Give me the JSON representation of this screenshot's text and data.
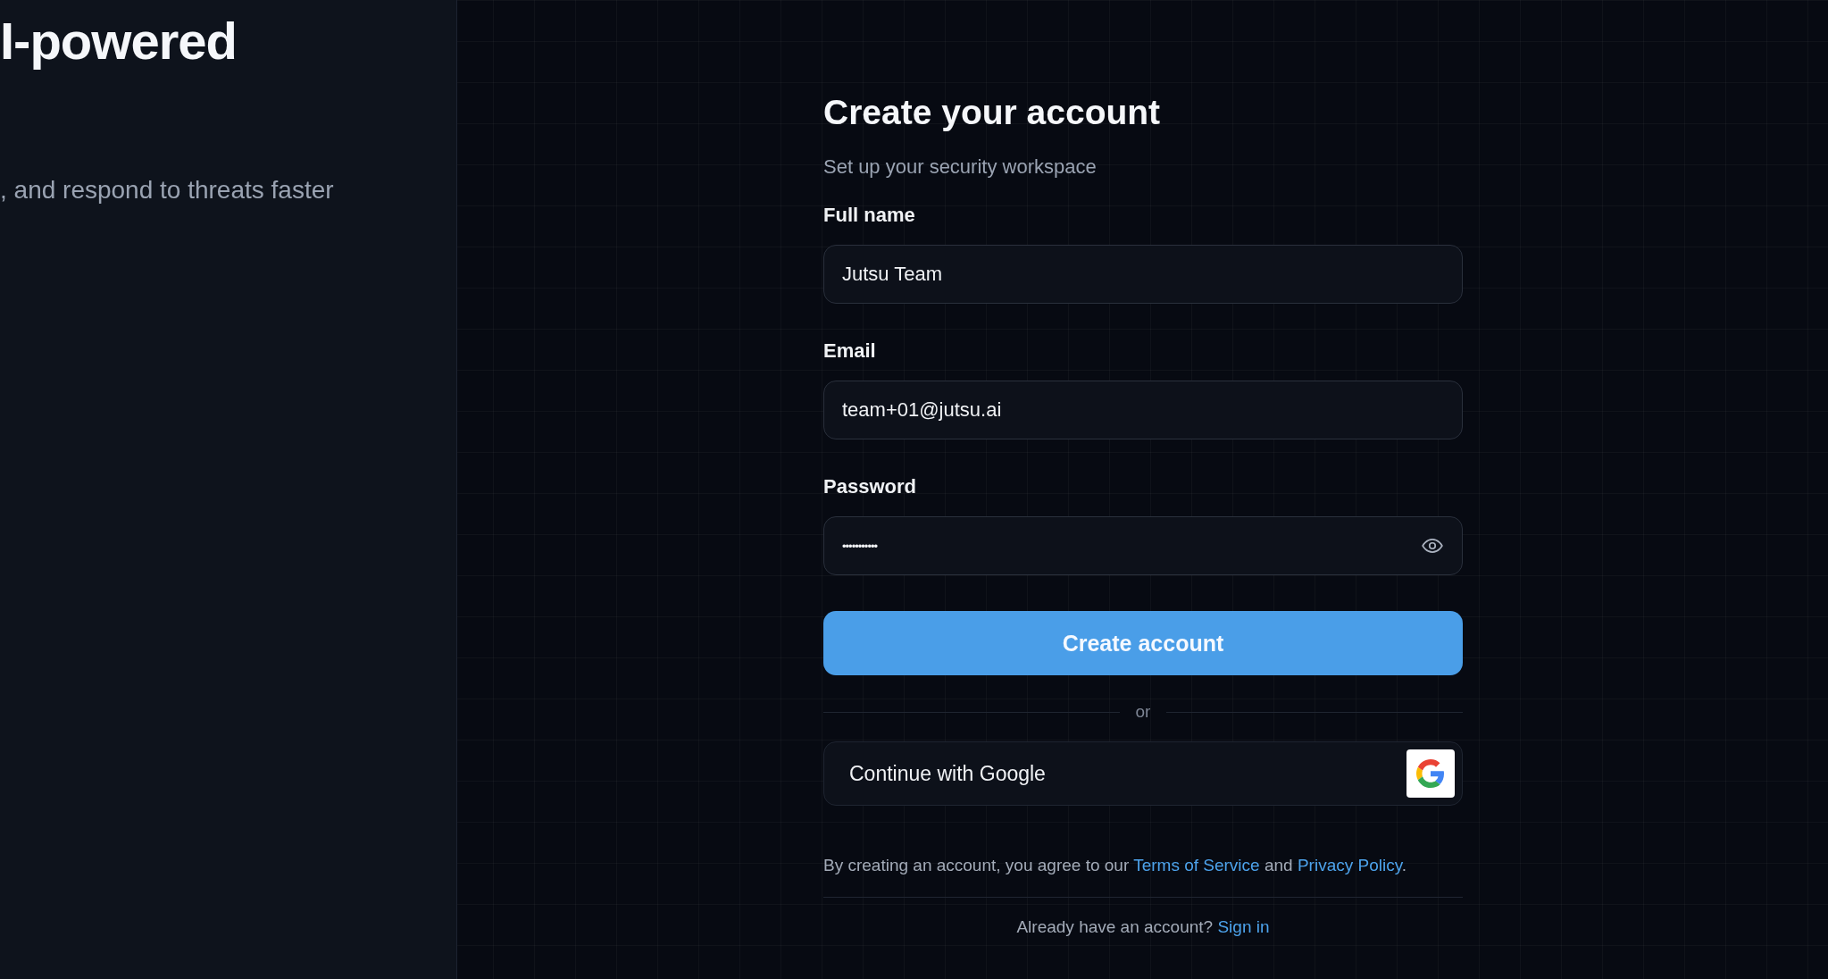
{
  "hero": {
    "heading": "I-powered",
    "tagline": ", and respond to threats faster"
  },
  "form": {
    "title": "Create your account",
    "subtitle": "Set up your security workspace",
    "fields": [
      {
        "kind": "text",
        "label": "Full name",
        "value": "Jutsu Team"
      },
      {
        "kind": "text",
        "label": "Email",
        "value": "team+01@jutsu.ai"
      },
      {
        "kind": "password",
        "label": "Password",
        "value": "•••••••••••"
      }
    ],
    "submit": "Create account",
    "divider": "or",
    "google": "Continue with Google",
    "terms": {
      "before": "By creating an account, you agree to our",
      "terms_link": "Terms of Service",
      "and": "and",
      "privacy_link": "Privacy Policy",
      "after": "."
    },
    "signin": {
      "prompt": "Already have an account?",
      "link": "Sign in"
    }
  }
}
